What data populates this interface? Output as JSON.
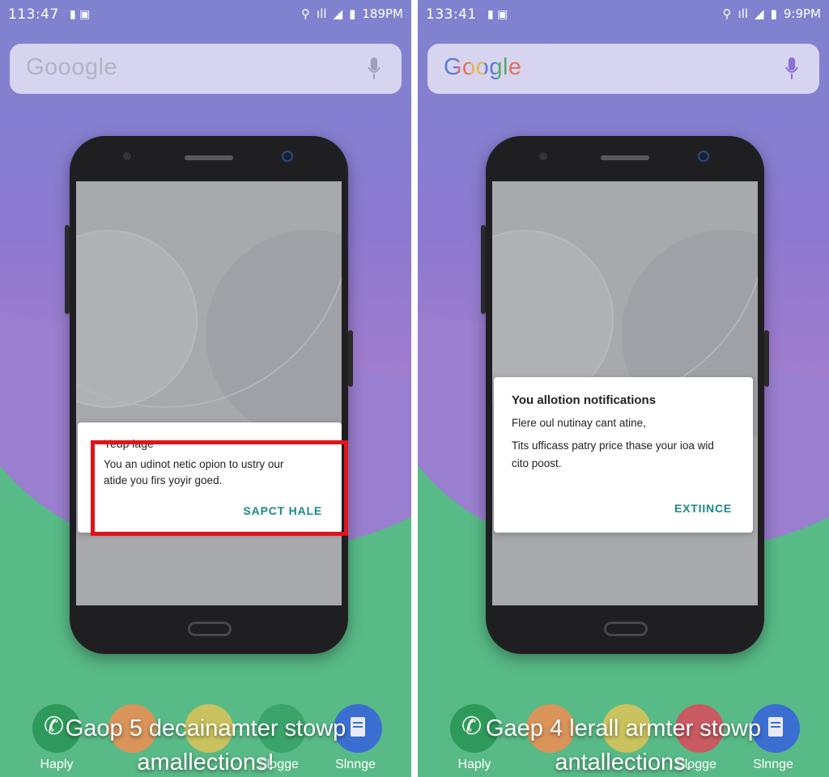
{
  "left": {
    "status": {
      "time": "113:47",
      "right_text": "189PM"
    },
    "search": {
      "logo": "Gooogle"
    },
    "dialog": {
      "title": "Yeup lage",
      "body_line1": "You an udinot netic opion to ustry our",
      "body_line2": "atide you firs yoyir goed.",
      "action": "SAPCT HALE"
    },
    "dock": [
      "Haply",
      "Slogge",
      "Slnnge"
    ],
    "caption_line1": "Gaop 5 decainamter stowp",
    "caption_line2": "amallections!"
  },
  "right": {
    "status": {
      "time": "133:41",
      "right_text": "9:9PM"
    },
    "search": {
      "logo": "Google"
    },
    "dialog": {
      "title": "You allotion notifications",
      "body_line1": "Flere oul nutinay cant atine,",
      "body_line2": "Tits ufficass patry price thase your ioa wid",
      "body_line3": "cito poost.",
      "action": "EXTIINCE"
    },
    "dock": [
      "Haply",
      "Slogge",
      "Slnnge"
    ],
    "caption_line1": "Gaep 4 lerall armter stowp",
    "caption_line2": "antallections."
  },
  "colors": {
    "highlight": "#e0141c",
    "action": "#1a8a86",
    "green": "#58ba86",
    "purple": "#8c7ad0"
  },
  "icons": [
    "phone-icon",
    "contact-icon",
    "document-icon",
    "mic-icon",
    "wifi-icon",
    "battery-icon"
  ]
}
